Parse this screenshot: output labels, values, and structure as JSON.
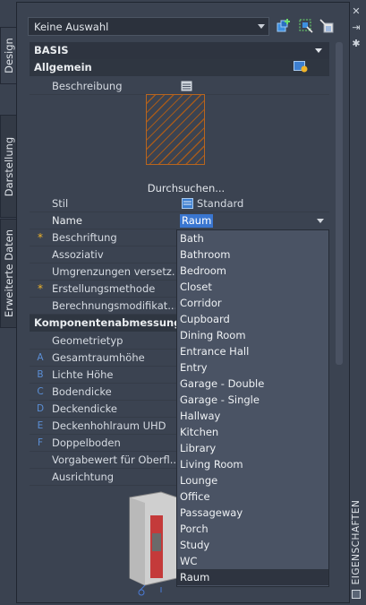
{
  "toolbar": {
    "selection_value": "Keine Auswahl"
  },
  "tabs": {
    "design": "Design",
    "darstellung": "Darstellung",
    "erweiterte": "Erweiterte Daten"
  },
  "side_label": "EIGENSCHAFTEN",
  "categories": {
    "basis": "BASIS",
    "allgemein": "Allgemein",
    "komponenten": "Komponentenabmessungen"
  },
  "properties": {
    "beschreibung": "Beschreibung",
    "browse": "Durchsuchen...",
    "stil": "Stil",
    "stil_value": "Standard",
    "name": "Name",
    "name_value": "Raum",
    "beschriftung": "Beschriftung",
    "assoziativ": "Assoziativ",
    "umgrenzungen": "Umgrenzungen versetz...",
    "erstellungsmethode": "Erstellungsmethode",
    "berechnung": "Berechnungsmodifikat...",
    "geometrietyp": "Geometrietyp",
    "gesamtraumhoehe": "Gesamtraumhöhe",
    "lichte_hoehe": "Lichte Höhe",
    "bodendicke": "Bodendicke",
    "deckendicke": "Deckendicke",
    "deckenhohlraum": "Deckenhohlraum UHD",
    "doppelboden": "Doppelboden",
    "vorgabewert": "Vorgabewert für Oberfl...",
    "ausrichtung": "Ausrichtung"
  },
  "prefixes": {
    "a": "A",
    "b": "B",
    "c": "C",
    "d": "D",
    "e": "E",
    "f": "F",
    "star": "*"
  },
  "dropdown_items": [
    "Bath",
    "Bathroom",
    "Bedroom",
    "Closet",
    "Corridor",
    "Cupboard",
    "Dining Room",
    "Entrance Hall",
    "Entry",
    "Garage - Double",
    "Garage - Single",
    "Hallway",
    "Kitchen",
    "Library",
    "Living Room",
    "Lounge",
    "Office",
    "Passageway",
    "Porch",
    "Study",
    "WC",
    "Raum"
  ],
  "colors": {
    "accent": "#3a76d0",
    "hatch": "#b8651e",
    "star": "#f0b429"
  }
}
